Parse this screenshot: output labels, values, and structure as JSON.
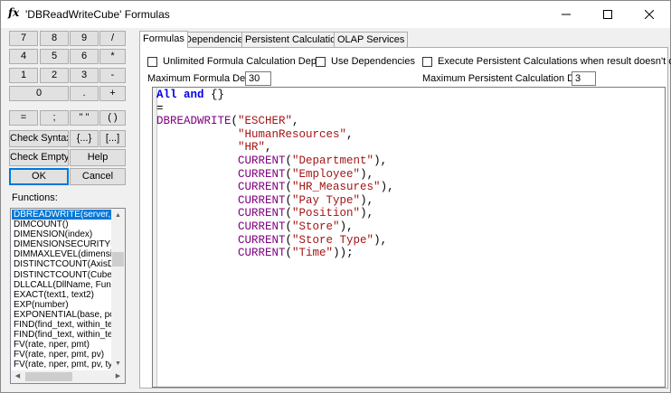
{
  "window": {
    "title": "'DBReadWriteCube' Formulas",
    "icon": "fx"
  },
  "colors": {
    "keyword": "#0000e6",
    "function": "#800080",
    "string": "#a31515",
    "selection": "#0078d7"
  },
  "keypad": {
    "row1": [
      "7",
      "8",
      "9",
      "/"
    ],
    "row2": [
      "4",
      "5",
      "6",
      "*"
    ],
    "row3": [
      "1",
      "2",
      "3",
      "-"
    ],
    "row4": [
      "0",
      ".",
      "+"
    ],
    "row5": [
      "=",
      ";",
      "\" \"",
      "( )"
    ],
    "check_syntax": "Check Syntax",
    "braces_btn": "{...}",
    "brackets_btn": "[...]",
    "check_empty": "Check Empty",
    "help": "Help",
    "ok": "OK",
    "cancel": "Cancel"
  },
  "functions": {
    "label": "Functions:",
    "items": [
      "DBREADWRITE(server, da",
      "DIMCOUNT()",
      "DIMENSION(index)",
      "DIMENSIONSECURITY(dim",
      "DIMMAXLEVEL(dimension)",
      "DISTINCTCOUNT(AxisDim",
      "DISTINCTCOUNT(Cube, A",
      "DLLCALL(DllName, Functic",
      "EXACT(text1, text2)",
      "EXP(number)",
      "EXPONENTIAL(base, powe",
      "FIND(find_text, within_text)",
      "FIND(find_text, within_text,",
      "FV(rate, nper, pmt)",
      "FV(rate, nper, pmt, pv)",
      "FV(rate, nper, pmt, pv, type"
    ]
  },
  "tabs": [
    "Formulas",
    "Dependencies",
    "Persistent Calculations",
    "OLAP Services"
  ],
  "options": {
    "unlimited_depth": "Unlimited Formula Calculation Depth",
    "use_dependencies": "Use Dependencies",
    "execute_persistent": "Execute Persistent Calculations when result doesn't change",
    "max_depth_label": "Maximum Formula Depth:",
    "max_depth_value": "30",
    "max_persistent_label": "Maximum Persistent Calculation Depth:",
    "max_persistent_value": "3"
  },
  "code": {
    "line1": {
      "kw1": "All",
      "kw2": "and",
      "rest": " {}"
    },
    "line2": "=",
    "fn_main": "DBREADWRITE",
    "args": [
      "\"ESCHER\"",
      "\"HumanResources\"",
      "\"HR\""
    ],
    "fn_current": "CURRENT",
    "current_args": [
      "\"Department\"",
      "\"Employee\"",
      "\"HR_Measures\"",
      "\"Pay Type\"",
      "\"Position\"",
      "\"Store\"",
      "\"Store Type\"",
      "\"Time\""
    ]
  }
}
